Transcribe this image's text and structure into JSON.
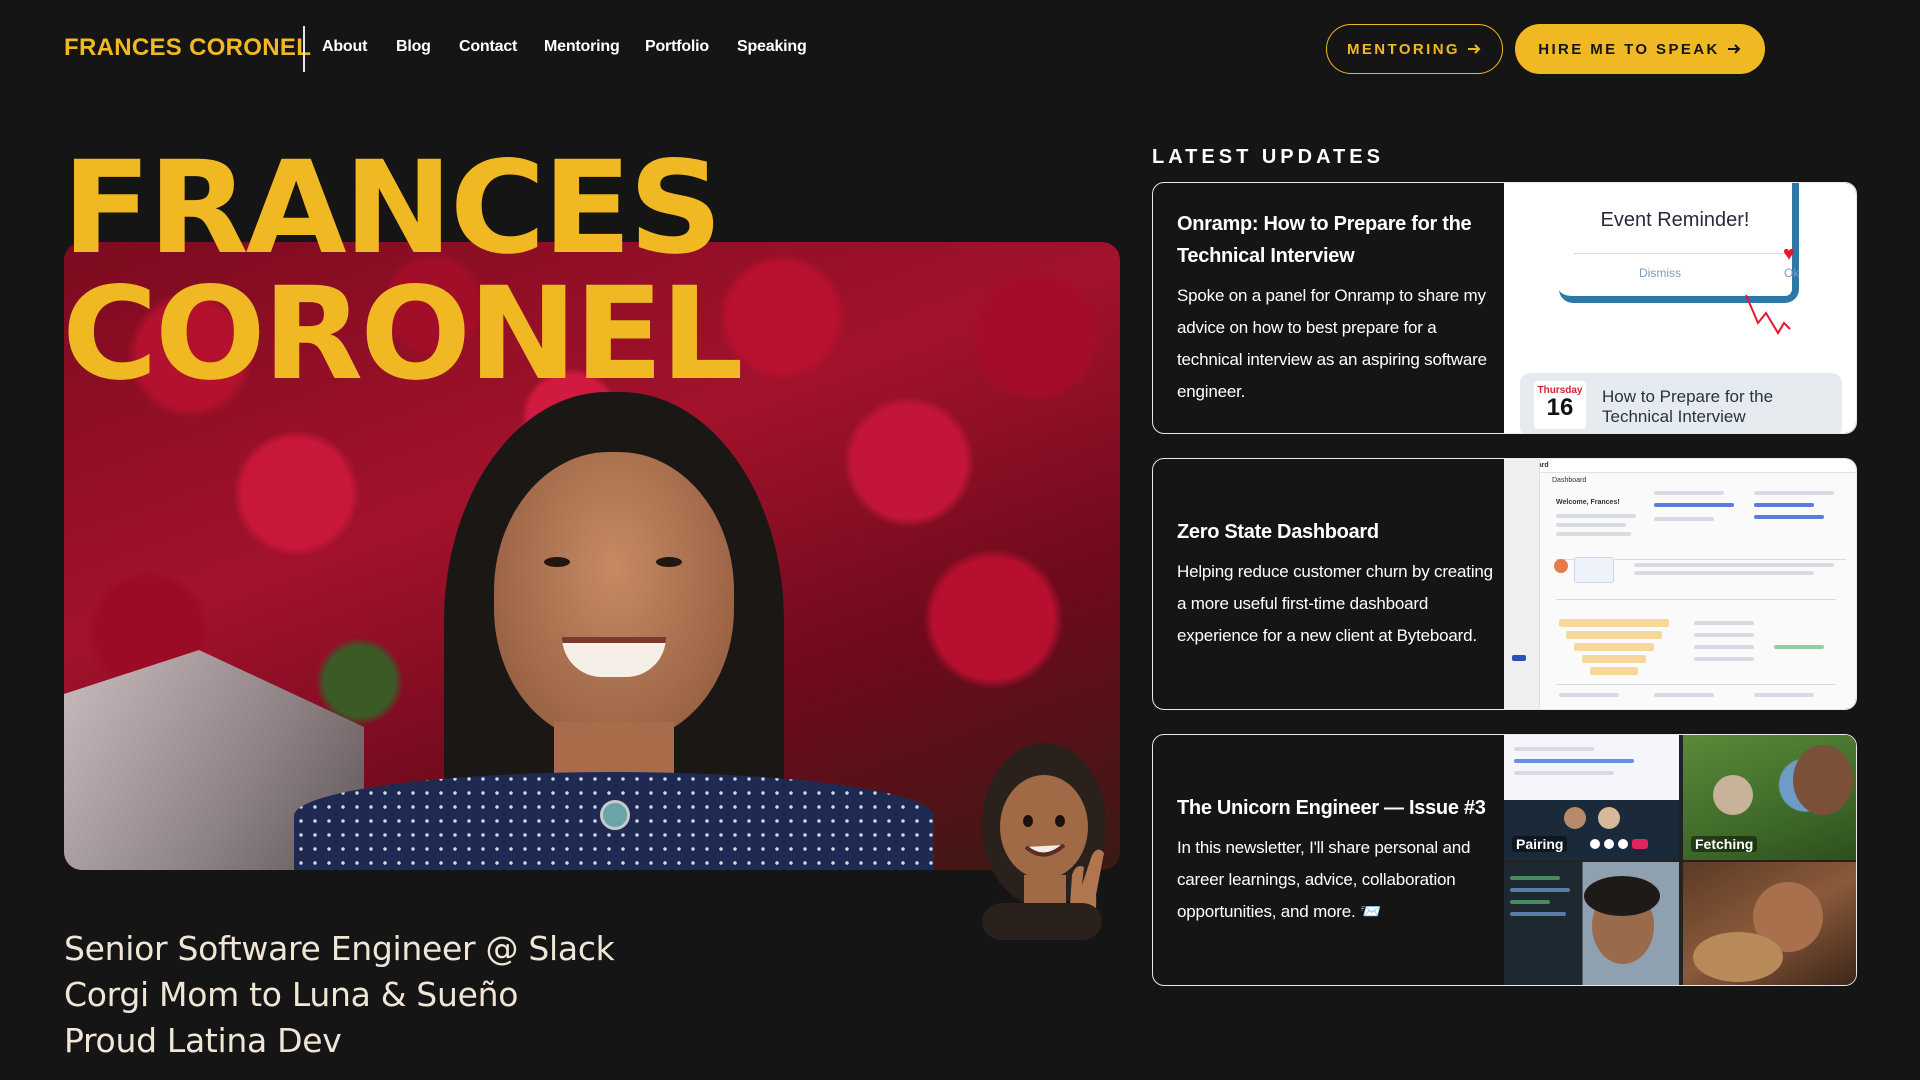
{
  "nav": {
    "brand": "FRANCES CORONEL",
    "links": [
      "About",
      "Blog",
      "Contact",
      "Mentoring",
      "Portfolio",
      "Speaking"
    ],
    "mentoring_button": "MENTORING",
    "hire_button": "HIRE ME TO SPEAK"
  },
  "hero": {
    "name_line1": "FRANCES",
    "name_line2": "CORONEL",
    "bio": [
      "Senior Software Engineer @ Slack",
      "Corgi Mom to Luna & Sueño",
      "Proud Latina Dev"
    ]
  },
  "updates": {
    "heading": "LATEST UPDATES",
    "cards": [
      {
        "title": "Onramp: How to Prepare for the Technical Interview",
        "description": "Spoke on a panel for Onramp to share my advice on how to best prepare for a technical interview as an aspiring software engineer.",
        "image": {
          "reminder_title": "Event Reminder!",
          "dismiss": "Dismiss",
          "ok": "Ok",
          "cal_day": "Thursday",
          "cal_num": "16",
          "event_line1": "How to Prepare for the",
          "event_line2": "Technical Interview"
        }
      },
      {
        "title": "Zero State Dashboard",
        "description": "Helping reduce customer churn by creating a more useful first-time dashboard experience for a new client at Byteboard.",
        "image": {
          "app_name": "Byteboard",
          "page_title": "Dashboard",
          "welcome": "Welcome, Frances!"
        }
      },
      {
        "title": "The Unicorn Engineer — Issue #3",
        "description": "In this newsletter, I'll share personal and career learnings, advice, collaboration opportunities, and more. 📨",
        "image": {
          "tile_labels": [
            "Pairing",
            "Fetching"
          ]
        }
      }
    ]
  },
  "colors": {
    "background": "#151515",
    "accent": "#f0b823"
  }
}
